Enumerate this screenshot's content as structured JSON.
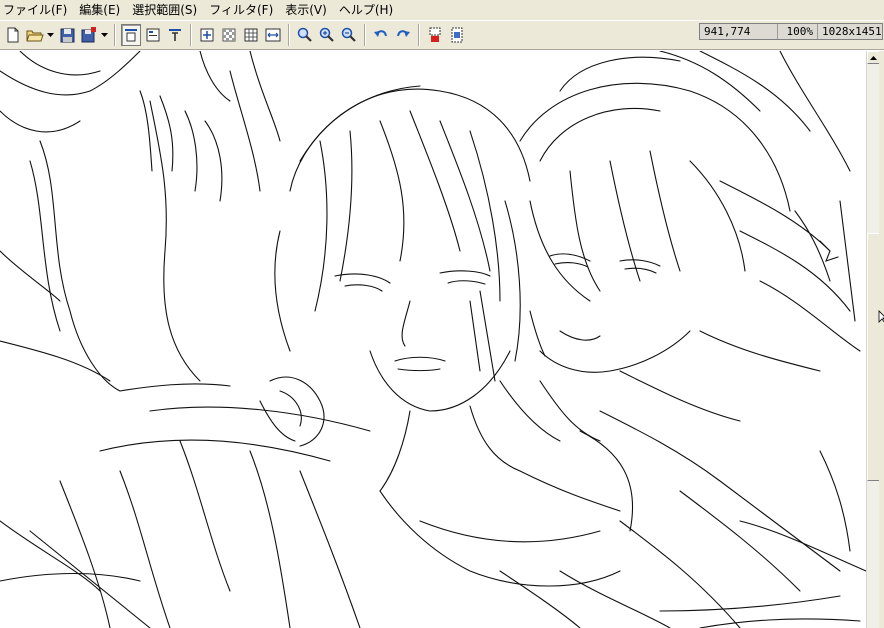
{
  "menu": {
    "items": [
      {
        "label": "ファイル(F)"
      },
      {
        "label": "編集(E)"
      },
      {
        "label": "選択範囲(S)"
      },
      {
        "label": "フィルタ(F)"
      },
      {
        "label": "表示(V)"
      },
      {
        "label": "ヘルプ(H)"
      }
    ]
  },
  "toolbar": {
    "icons": [
      "new-file-icon",
      "open-folder-icon",
      "save-icon",
      "save-as-icon",
      "align-top-icon",
      "align-center-icon",
      "align-text-icon",
      "fit-window-icon",
      "transparency-checker-icon",
      "grid-icon",
      "fit-width-icon",
      "zoom-search-icon",
      "zoom-in-icon",
      "zoom-out-icon",
      "undo-icon",
      "redo-icon",
      "layer-red-icon",
      "layer-blue-icon"
    ]
  },
  "status": {
    "coordinates": "941,774",
    "zoom": "100%",
    "image_size": "1028x1451"
  },
  "colors": {
    "chrome": "#ece9d8",
    "undo_blue": "#1f5fbf",
    "toolbar_blue": "#1d4fa8",
    "red_accent": "#d62020"
  }
}
